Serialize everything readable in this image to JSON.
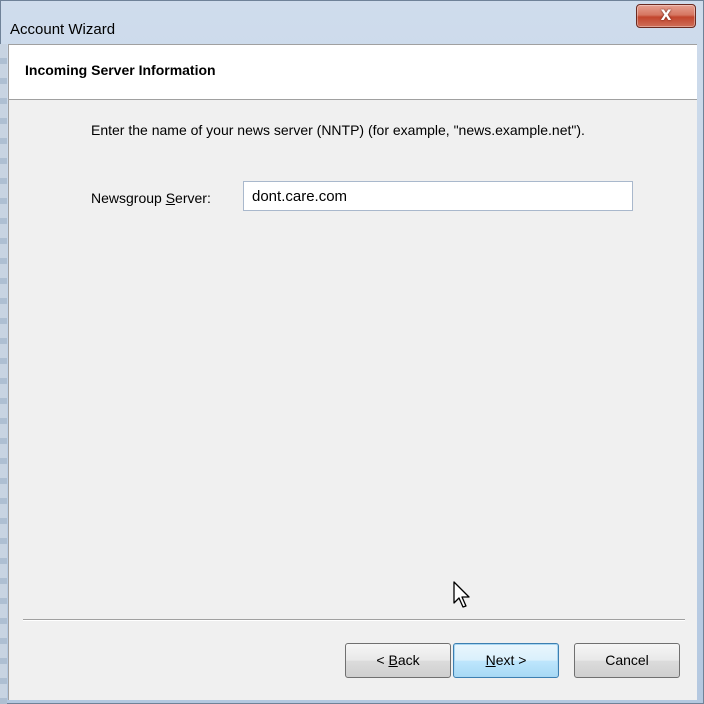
{
  "window": {
    "title": "Account Wizard",
    "close_glyph": "X"
  },
  "header": {
    "title": "Incoming Server Information"
  },
  "main": {
    "description": "Enter the name of your news server (NNTP) (for example, \"news.example.net\").",
    "server_label_before": "Newsgroup ",
    "server_label_accel": "S",
    "server_label_after": "erver:",
    "server_value": "dont.care.com"
  },
  "buttons": {
    "back_prefix": "< ",
    "back_accel": "B",
    "back_rest": "ack",
    "next_accel": "N",
    "next_rest": "ext >",
    "cancel": "Cancel"
  },
  "icons": {
    "close": "close-icon",
    "cursor": "mouse-pointer-icon"
  }
}
